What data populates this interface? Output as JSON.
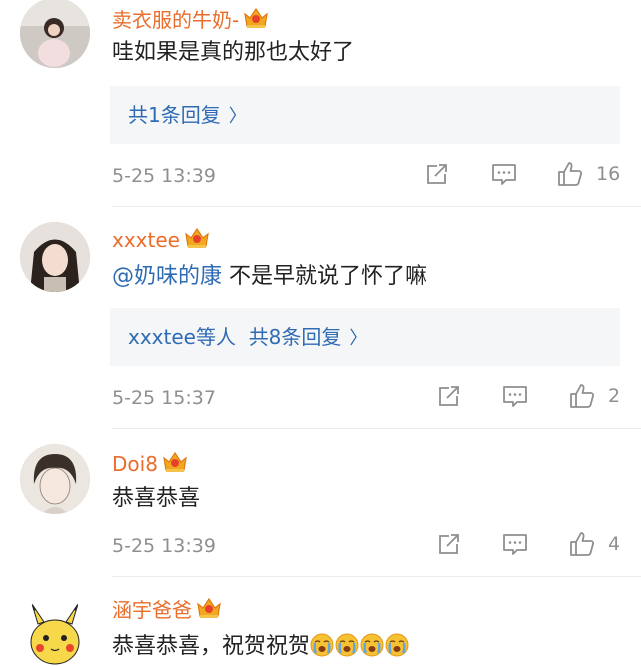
{
  "comments": [
    {
      "username": "卖衣服的牛奶-",
      "text": "哇如果是真的那也太好了",
      "replies": {
        "count_label": "共1条回复"
      },
      "time": "5-25 13:39",
      "likes": "16"
    },
    {
      "username": "xxxtee",
      "mention": "@奶味的康",
      "text": " 不是早就说了怀了嘛",
      "replies": {
        "users_label": "xxxtee等人",
        "count_label": "共8条回复"
      },
      "time": "5-25 15:37",
      "likes": "2"
    },
    {
      "username": "Doi8",
      "text": "恭喜恭喜",
      "time": "5-25 13:39",
      "likes": "4"
    },
    {
      "username": "涵宇爸爸",
      "text": "恭喜恭喜，祝贺祝贺"
    }
  ],
  "icons": {
    "crown": "vip-crown-icon",
    "repost": "repost-icon",
    "comment": "comment-icon",
    "like": "thumbs-up-icon",
    "chevron": "chevron-right-icon"
  },
  "colors": {
    "username": "#ea6d2b",
    "link": "#2f6bb3",
    "meta": "#8f8f8f"
  }
}
